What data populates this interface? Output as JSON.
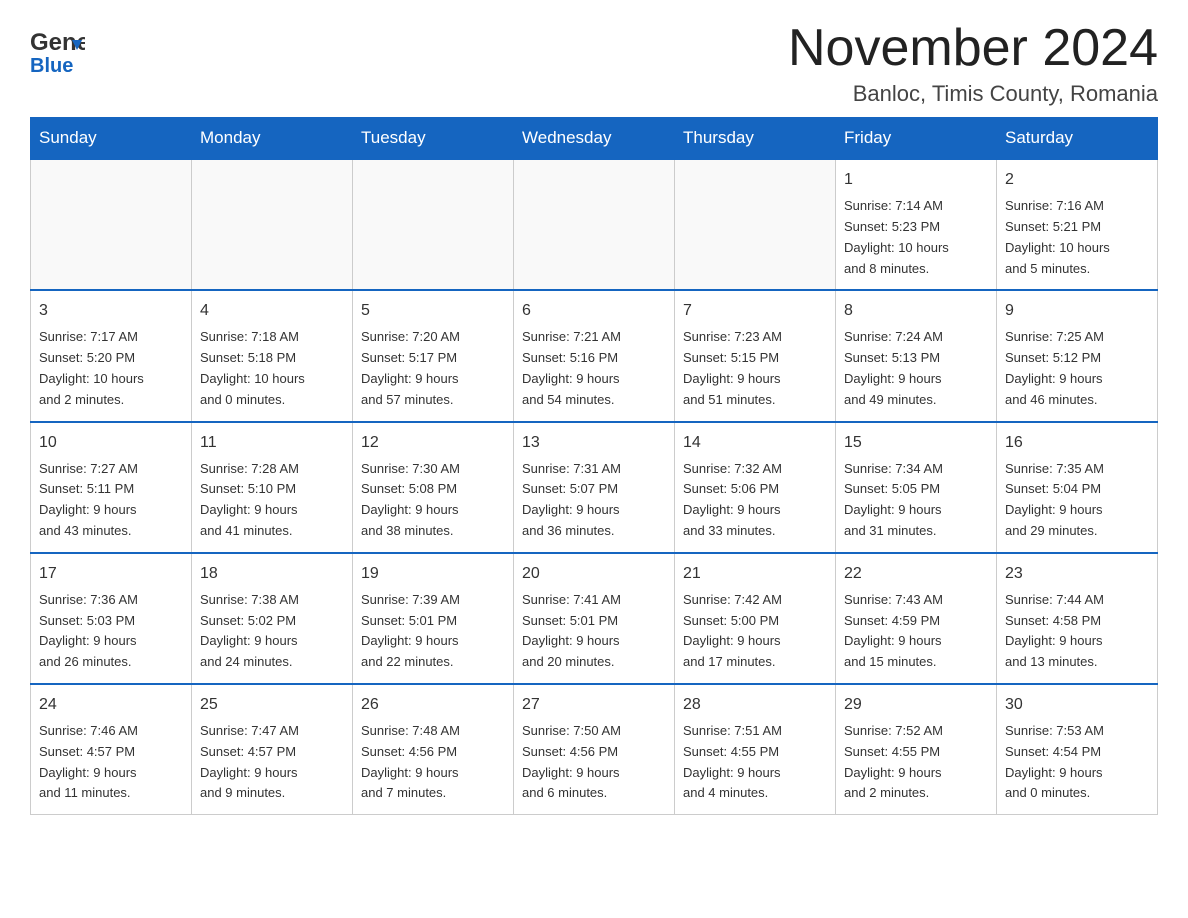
{
  "logo": {
    "general": "General",
    "blue": "Blue"
  },
  "title": {
    "month_year": "November 2024",
    "location": "Banloc, Timis County, Romania"
  },
  "weekdays": [
    "Sunday",
    "Monday",
    "Tuesday",
    "Wednesday",
    "Thursday",
    "Friday",
    "Saturday"
  ],
  "weeks": [
    [
      {
        "day": "",
        "info": ""
      },
      {
        "day": "",
        "info": ""
      },
      {
        "day": "",
        "info": ""
      },
      {
        "day": "",
        "info": ""
      },
      {
        "day": "",
        "info": ""
      },
      {
        "day": "1",
        "info": "Sunrise: 7:14 AM\nSunset: 5:23 PM\nDaylight: 10 hours\nand 8 minutes."
      },
      {
        "day": "2",
        "info": "Sunrise: 7:16 AM\nSunset: 5:21 PM\nDaylight: 10 hours\nand 5 minutes."
      }
    ],
    [
      {
        "day": "3",
        "info": "Sunrise: 7:17 AM\nSunset: 5:20 PM\nDaylight: 10 hours\nand 2 minutes."
      },
      {
        "day": "4",
        "info": "Sunrise: 7:18 AM\nSunset: 5:18 PM\nDaylight: 10 hours\nand 0 minutes."
      },
      {
        "day": "5",
        "info": "Sunrise: 7:20 AM\nSunset: 5:17 PM\nDaylight: 9 hours\nand 57 minutes."
      },
      {
        "day": "6",
        "info": "Sunrise: 7:21 AM\nSunset: 5:16 PM\nDaylight: 9 hours\nand 54 minutes."
      },
      {
        "day": "7",
        "info": "Sunrise: 7:23 AM\nSunset: 5:15 PM\nDaylight: 9 hours\nand 51 minutes."
      },
      {
        "day": "8",
        "info": "Sunrise: 7:24 AM\nSunset: 5:13 PM\nDaylight: 9 hours\nand 49 minutes."
      },
      {
        "day": "9",
        "info": "Sunrise: 7:25 AM\nSunset: 5:12 PM\nDaylight: 9 hours\nand 46 minutes."
      }
    ],
    [
      {
        "day": "10",
        "info": "Sunrise: 7:27 AM\nSunset: 5:11 PM\nDaylight: 9 hours\nand 43 minutes."
      },
      {
        "day": "11",
        "info": "Sunrise: 7:28 AM\nSunset: 5:10 PM\nDaylight: 9 hours\nand 41 minutes."
      },
      {
        "day": "12",
        "info": "Sunrise: 7:30 AM\nSunset: 5:08 PM\nDaylight: 9 hours\nand 38 minutes."
      },
      {
        "day": "13",
        "info": "Sunrise: 7:31 AM\nSunset: 5:07 PM\nDaylight: 9 hours\nand 36 minutes."
      },
      {
        "day": "14",
        "info": "Sunrise: 7:32 AM\nSunset: 5:06 PM\nDaylight: 9 hours\nand 33 minutes."
      },
      {
        "day": "15",
        "info": "Sunrise: 7:34 AM\nSunset: 5:05 PM\nDaylight: 9 hours\nand 31 minutes."
      },
      {
        "day": "16",
        "info": "Sunrise: 7:35 AM\nSunset: 5:04 PM\nDaylight: 9 hours\nand 29 minutes."
      }
    ],
    [
      {
        "day": "17",
        "info": "Sunrise: 7:36 AM\nSunset: 5:03 PM\nDaylight: 9 hours\nand 26 minutes."
      },
      {
        "day": "18",
        "info": "Sunrise: 7:38 AM\nSunset: 5:02 PM\nDaylight: 9 hours\nand 24 minutes."
      },
      {
        "day": "19",
        "info": "Sunrise: 7:39 AM\nSunset: 5:01 PM\nDaylight: 9 hours\nand 22 minutes."
      },
      {
        "day": "20",
        "info": "Sunrise: 7:41 AM\nSunset: 5:01 PM\nDaylight: 9 hours\nand 20 minutes."
      },
      {
        "day": "21",
        "info": "Sunrise: 7:42 AM\nSunset: 5:00 PM\nDaylight: 9 hours\nand 17 minutes."
      },
      {
        "day": "22",
        "info": "Sunrise: 7:43 AM\nSunset: 4:59 PM\nDaylight: 9 hours\nand 15 minutes."
      },
      {
        "day": "23",
        "info": "Sunrise: 7:44 AM\nSunset: 4:58 PM\nDaylight: 9 hours\nand 13 minutes."
      }
    ],
    [
      {
        "day": "24",
        "info": "Sunrise: 7:46 AM\nSunset: 4:57 PM\nDaylight: 9 hours\nand 11 minutes."
      },
      {
        "day": "25",
        "info": "Sunrise: 7:47 AM\nSunset: 4:57 PM\nDaylight: 9 hours\nand 9 minutes."
      },
      {
        "day": "26",
        "info": "Sunrise: 7:48 AM\nSunset: 4:56 PM\nDaylight: 9 hours\nand 7 minutes."
      },
      {
        "day": "27",
        "info": "Sunrise: 7:50 AM\nSunset: 4:56 PM\nDaylight: 9 hours\nand 6 minutes."
      },
      {
        "day": "28",
        "info": "Sunrise: 7:51 AM\nSunset: 4:55 PM\nDaylight: 9 hours\nand 4 minutes."
      },
      {
        "day": "29",
        "info": "Sunrise: 7:52 AM\nSunset: 4:55 PM\nDaylight: 9 hours\nand 2 minutes."
      },
      {
        "day": "30",
        "info": "Sunrise: 7:53 AM\nSunset: 4:54 PM\nDaylight: 9 hours\nand 0 minutes."
      }
    ]
  ]
}
